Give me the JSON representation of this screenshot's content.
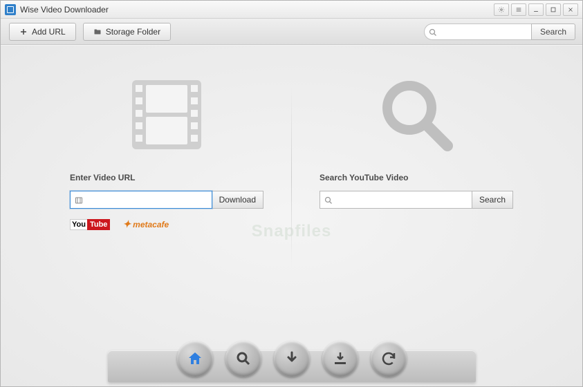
{
  "title": "Wise Video Downloader",
  "toolbar": {
    "add_url_label": "Add URL",
    "storage_folder_label": "Storage Folder",
    "search_btn_label": "Search"
  },
  "left_panel": {
    "heading": "Enter Video URL",
    "button_label": "Download"
  },
  "right_panel": {
    "heading": "Search YouTube Video",
    "button_label": "Search"
  },
  "brands": {
    "youtube_you": "You",
    "youtube_tube": "Tube",
    "metacafe": "metacafe"
  },
  "watermark": "Snapfiles",
  "dock": {
    "home": "home-icon",
    "search": "search-icon",
    "download": "download-icon",
    "save": "save-download-icon",
    "refresh": "refresh-icon"
  }
}
